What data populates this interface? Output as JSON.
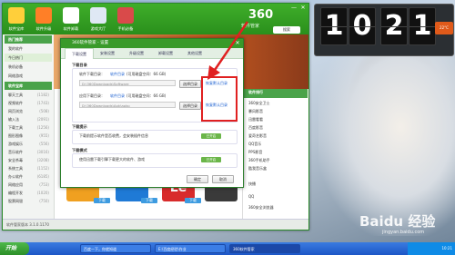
{
  "window": {
    "logo": "360",
    "logo_sub": "软件管家",
    "search_label": "搜索",
    "top_buttons": [
      "软件宝库",
      "软件升级",
      "软件卸载",
      "游戏大厅",
      "手机必备"
    ],
    "min": "—",
    "close": "✕"
  },
  "sidebar": {
    "items": [
      {
        "label": "热门推荐",
        "count": "",
        "head": true
      },
      {
        "label": "我的软件",
        "count": "",
        "head": false
      },
      {
        "label": "今日热门",
        "count": "",
        "head": false,
        "active": true
      },
      {
        "label": "装机必备",
        "count": "",
        "head": false
      },
      {
        "label": "网络游戏",
        "count": "",
        "head": false
      },
      {
        "label": "软件宝库",
        "count": "",
        "head": true
      },
      {
        "label": "聊天工具",
        "count": "(1182)",
        "head": false
      },
      {
        "label": "视频软件",
        "count": "(1743)",
        "head": false
      },
      {
        "label": "网页浏览",
        "count": "(508)",
        "head": false
      },
      {
        "label": "输入法",
        "count": "(2091)",
        "head": false
      },
      {
        "label": "下载工具",
        "count": "(1256)",
        "head": false
      },
      {
        "label": "图形图像",
        "count": "(955)",
        "head": false
      },
      {
        "label": "游戏娱乐",
        "count": "(556)",
        "head": false
      },
      {
        "label": "音乐软件",
        "count": "(3016)",
        "head": false
      },
      {
        "label": "安全杀毒",
        "count": "(3208)",
        "head": false
      },
      {
        "label": "系统工具",
        "count": "(1152)",
        "head": false
      },
      {
        "label": "办公软件",
        "count": "(6185)",
        "head": false
      },
      {
        "label": "网络应用",
        "count": "(753)",
        "head": false
      },
      {
        "label": "编程开发",
        "count": "(1020)",
        "head": false
      },
      {
        "label": "股票网银",
        "count": "(750)",
        "head": false
      }
    ]
  },
  "statusbar": {
    "text": "软件管家版本  3.1.0.1170"
  },
  "dialog": {
    "title": "360软件管家 - 设置",
    "close": "✕",
    "tabs": [
      "下载设置",
      "安装设置",
      "升级设置",
      "卸载设置",
      "其他设置"
    ],
    "section_download": "下载目录",
    "pkg_dir_label": "软件下载目录：",
    "pkg_dir_hint": "(可用磁盘空间：66 GB)",
    "pkg_dir_hint_link": "软件目录",
    "pkg_dir_path": "D:\\360Downloads\\Software",
    "app_dir_label": "应用下载目录：",
    "app_dir_hint": "(可用磁盘空间：66 GB)",
    "app_dir_hint_link": "软件目录",
    "app_dir_path": "D:\\360Downloads\\Apk\\apkp",
    "choose_dir": "选择目录",
    "restore_default": "恢复默认目录",
    "section_notify": "下载提示",
    "notify_text": "下载前提示软件是否收费，会安装插件信息",
    "notify_state": "已开启",
    "section_mode": "下载模式",
    "mode_text": "使用迅雷下载引擎下载更大的软件、游戏",
    "mode_state": "已开启",
    "ok": "确定",
    "cancel": "取消"
  },
  "right_panel": {
    "title": "软件排行",
    "items": [
      "360安全卫士",
      "暴风影音",
      "迅雷看看",
      "百度影音",
      "爱奇艺影音",
      "QQ音乐",
      "PPS影音",
      "360手机助手",
      "酷我音乐盒",
      "快播",
      "QQ",
      "360安全浏览器"
    ]
  },
  "thumbs": [
    "微博",
    "下载",
    "下载",
    "Le",
    "下载"
  ],
  "clock": {
    "digits": [
      "1",
      "0",
      "2",
      "1"
    ],
    "weather": "22°C"
  },
  "taskbar": {
    "start": "开始",
    "tasks": [
      "百度一下，你就知道",
      "E:\\百度经验\\作业",
      "360软件管家"
    ],
    "time": "10:21"
  },
  "watermark": {
    "main": "Baidu 经验",
    "sub": "jingyan.baidu.com"
  },
  "colors": {
    "accent_green": "#3fae2a",
    "highlight_red": "#e02020",
    "link_blue": "#1a5fd0"
  }
}
